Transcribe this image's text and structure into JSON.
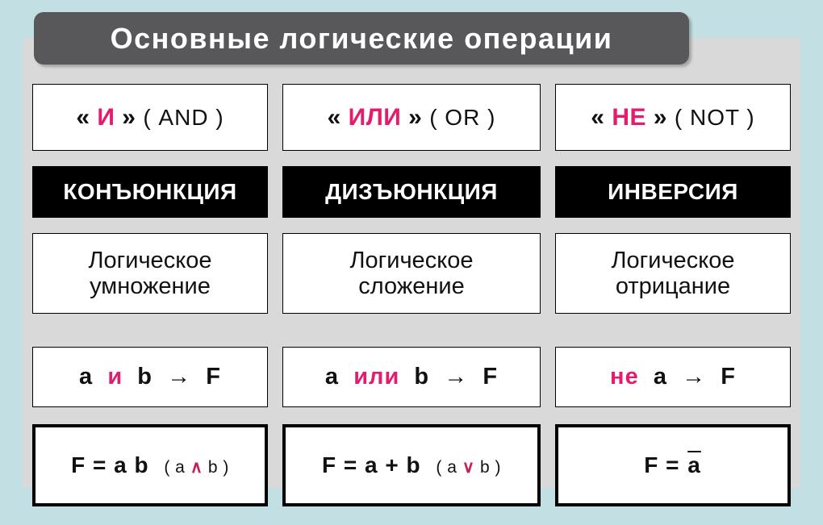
{
  "title": "Основные логические операции",
  "colors": {
    "background": "#c2e0e3",
    "panel": "#d9d9d9",
    "title_plaque": "#58585a",
    "accent_pink": "#e31c6d",
    "term_bg": "#000000",
    "text": "#111111"
  },
  "columns": [
    {
      "name": {
        "open_guillemet": "«",
        "operator": "И",
        "close_guillemet": "»",
        "english": "( AND )"
      },
      "term": "КОНЪЮНКЦИЯ",
      "description_line1": "Логическое",
      "description_line2": "умножение",
      "expression": {
        "left": "a",
        "connective": "и",
        "right": "b",
        "arrow": "→",
        "result": "F"
      },
      "formula": {
        "main": "F = a b",
        "alt_open": "( a",
        "alt_symbol": "∧",
        "alt_close": "b )"
      }
    },
    {
      "name": {
        "open_guillemet": "«",
        "operator": "ИЛИ",
        "close_guillemet": "»",
        "english": "( OR )"
      },
      "term": "ДИЗЪЮНКЦИЯ",
      "description_line1": "Логическое",
      "description_line2": "сложение",
      "expression": {
        "left": "a",
        "connective": "или",
        "right": "b",
        "arrow": "→",
        "result": "F"
      },
      "formula": {
        "main": "F = a + b",
        "alt_open": "( a",
        "alt_symbol": "∨",
        "alt_close": "b )"
      }
    },
    {
      "name": {
        "open_guillemet": "«",
        "operator": "НЕ",
        "close_guillemet": "»",
        "english": "( NOT )"
      },
      "term": "ИНВЕРСИЯ",
      "description_line1": "Логическое",
      "description_line2": "отрицание",
      "expression": {
        "left": "",
        "connective": "не",
        "right": "a",
        "arrow": "→",
        "result": "F"
      },
      "formula": {
        "main_prefix": "F = ",
        "main_overlined": "a",
        "alt_open": "",
        "alt_symbol": "",
        "alt_close": ""
      }
    }
  ]
}
